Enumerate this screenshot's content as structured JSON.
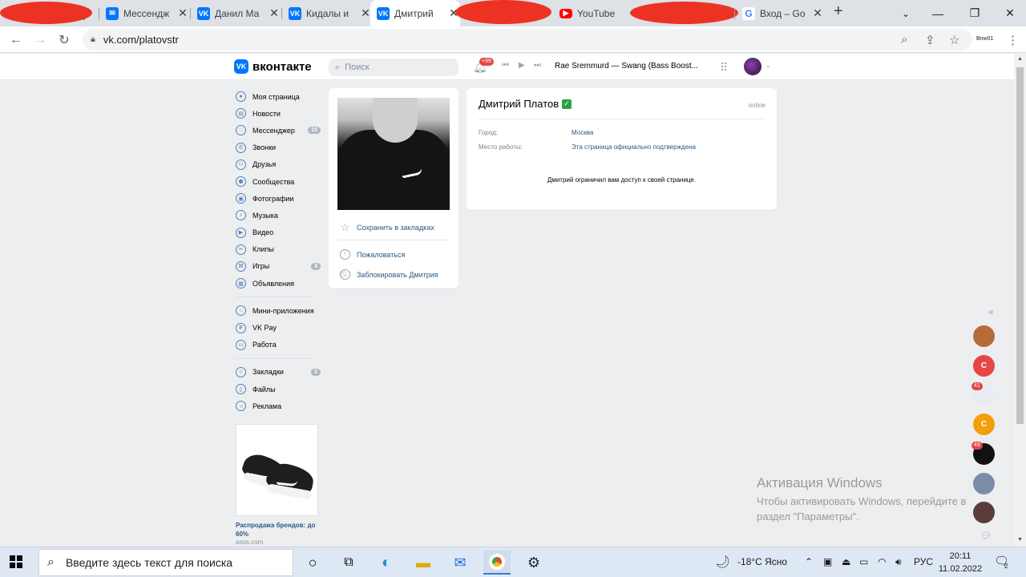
{
  "browser": {
    "tabs": [
      {
        "title": "Мессендж",
        "favicon": "vk"
      },
      {
        "title": "Данил Ма",
        "favicon": "vk"
      },
      {
        "title": "Кидалы и",
        "favicon": "vk"
      },
      {
        "title": "Дмитрий",
        "favicon": "vk",
        "active": true
      },
      {
        "title": "YouTube",
        "favicon": "youtube"
      },
      {
        "title": "Вход – Go",
        "favicon": "google"
      }
    ],
    "new_tab": "+",
    "url": "vk.com/platovstr",
    "extension_label": "Bnw01"
  },
  "vk_header": {
    "logo": "вконтакте",
    "logo_mark": "VK",
    "search_placeholder": "Поиск",
    "notif_badge": "+99",
    "track": "Rae Sremmurd — Swang (Bass Boost..."
  },
  "sidebar": {
    "items": [
      {
        "label": "Моя страница",
        "icon": "user-icon"
      },
      {
        "label": "Новости",
        "icon": "news-icon"
      },
      {
        "label": "Мессенджер",
        "icon": "message-icon",
        "badge": "15"
      },
      {
        "label": "Звонки",
        "icon": "phone-icon"
      },
      {
        "label": "Друзья",
        "icon": "friends-icon"
      },
      {
        "label": "Сообщества",
        "icon": "groups-icon"
      },
      {
        "label": "Фотографии",
        "icon": "photo-icon"
      },
      {
        "label": "Музыка",
        "icon": "music-icon"
      },
      {
        "label": "Видео",
        "icon": "video-icon"
      },
      {
        "label": "Клипы",
        "icon": "clips-icon"
      },
      {
        "label": "Игры",
        "icon": "games-icon",
        "badge": "3"
      },
      {
        "label": "Объявления",
        "icon": "ads-icon"
      }
    ],
    "items2": [
      {
        "label": "Мини-приложения",
        "icon": "apps-icon"
      },
      {
        "label": "VK Pay",
        "icon": "pay-icon"
      },
      {
        "label": "Работа",
        "icon": "work-icon"
      }
    ],
    "items3": [
      {
        "label": "Закладки",
        "icon": "bookmark-icon",
        "badge": "2"
      },
      {
        "label": "Файлы",
        "icon": "file-icon"
      },
      {
        "label": "Реклама",
        "icon": "megaphone-icon"
      }
    ],
    "ad": {
      "title": "Распродажа брендов: до 60%",
      "source": "asos.com"
    }
  },
  "profile_actions": {
    "save": "Сохранить в закладках",
    "report": "Пожаловаться",
    "block": "Заблокировать Дмитрия"
  },
  "profile": {
    "name": "Дмитрий Платов",
    "verified": "✓",
    "status": "online",
    "city_label": "Город:",
    "city": "Москва",
    "work_label": "Место работы:",
    "work": "Эта страница официально подтверждена",
    "restricted": "Дмитрий ограничил вам доступ к своей странице."
  },
  "right_chats": [
    {
      "color": "#b86b3a"
    },
    {
      "letter": "С",
      "color": "#e64646"
    },
    {
      "badge": "41",
      "color": "#e8edf2"
    },
    {
      "letter": "С",
      "color": "#f59e0b"
    },
    {
      "badge": "49",
      "color": "#111111"
    },
    {
      "color": "#7a8ca8"
    },
    {
      "color": "#5a3d3a"
    }
  ],
  "watermark": {
    "title": "Активация Windows",
    "line1": "Чтобы активировать Windows, перейдите в",
    "line2": "раздел \"Параметры\"."
  },
  "taskbar": {
    "search_placeholder": "Введите здесь текст для поиска",
    "weather": "-18°C  Ясно",
    "lang": "РУС",
    "time": "20:11",
    "date": "11.02.2022",
    "notif_count": "2"
  }
}
